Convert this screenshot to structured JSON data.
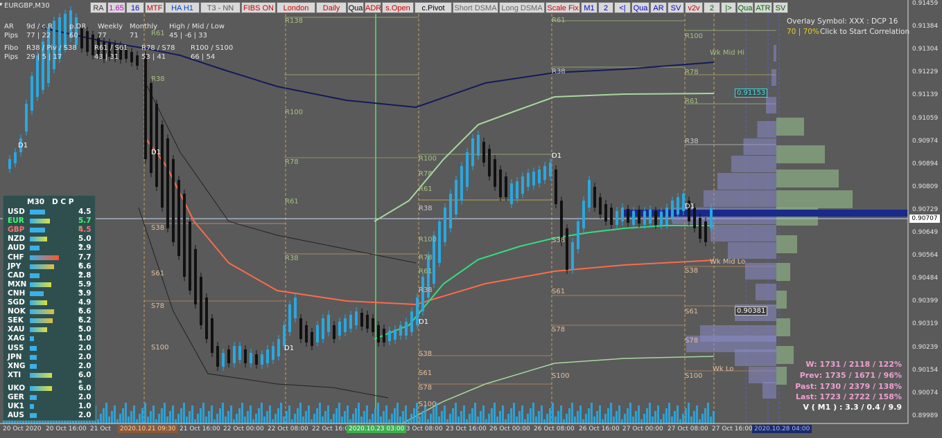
{
  "window": {
    "title": "EURGBP,M30"
  },
  "toolbar": [
    {
      "label": "RA",
      "color": "#333333"
    },
    {
      "label": "1.65",
      "color": "#cc00cc"
    },
    {
      "label": "16",
      "color": "#0000cc"
    },
    {
      "label": "MTF",
      "color": "#cc0000"
    },
    {
      "label": "HA H1",
      "color": "#0044cc"
    },
    {
      "label": "T3 - NN",
      "color": "#555555"
    },
    {
      "label": "FIBS ON",
      "color": "#cc0000"
    },
    {
      "label": "London",
      "color": "#cc0000"
    },
    {
      "label": "Daily",
      "color": "#cc0000"
    },
    {
      "label": "Qua",
      "color": "#000000"
    },
    {
      "label": "ADR",
      "color": "#cc0000"
    },
    {
      "label": "s.Open",
      "color": "#cc0000"
    },
    {
      "label": "c.Pivot",
      "color": "#000000"
    },
    {
      "label": "Short DSMA",
      "color": "#666666"
    },
    {
      "label": "Long DSMA",
      "color": "#666666"
    },
    {
      "label": "Scale Fix",
      "color": "#cc0000"
    },
    {
      "label": "M1",
      "color": "#0000cc"
    },
    {
      "label": "2",
      "color": "#0000cc"
    },
    {
      "label": "<|",
      "color": "#0000cc"
    },
    {
      "label": "Qua",
      "color": "#0000cc"
    },
    {
      "label": "AR",
      "color": "#0000cc"
    },
    {
      "label": "SV",
      "color": "#0000cc"
    },
    {
      "label": "v2v",
      "color": "#cc0000"
    },
    {
      "label": "2",
      "color": "#006600"
    },
    {
      "label": "|>",
      "color": "#006600"
    },
    {
      "label": "Qua",
      "color": "#006600"
    },
    {
      "label": "ATR",
      "color": "#006600"
    },
    {
      "label": "SV",
      "color": "#006600"
    }
  ],
  "price_axis": [
    "0.91459",
    "0.91384",
    "0.91304",
    "0.91229",
    "0.91139",
    "0.91059",
    "0.90974",
    "0.90894",
    "0.90809",
    "0.90729",
    "0.90649",
    "0.90564",
    "0.90484",
    "0.90399",
    "0.90319",
    "0.90239",
    "0.90154",
    "0.90074",
    "0.89989"
  ],
  "price_current": "0.90707",
  "price_markers": [
    {
      "label": "0.91153",
      "color": "#44dddd"
    },
    {
      "label": "0.90381",
      "color": "#ffffff"
    }
  ],
  "time_axis": [
    "20 Oct 2020",
    "20 Oct 16:00",
    "21 Oct",
    "21 Oct 16:00",
    "22 Oct 00:00",
    "22 Oct 08:00",
    "22 Oct 16:00",
    "23 Oct 08:00",
    "23 Oct 16:00",
    "26 Oct 00:00",
    "26 Oct 08:00",
    "26 Oct 16:00",
    "27 Oct 00:00",
    "27 Oct 08:00",
    "27 Oct 16:00"
  ],
  "time_highlights": [
    {
      "label": "2020.10.21 09:30",
      "bg": "#8a5a3a",
      "color": "#ffd0a0"
    },
    {
      "label": "2020.10.23 03:00",
      "bg": "#3ab04a",
      "color": "#ffffff"
    },
    {
      "label": "2020.10.28 04:00",
      "bg": "#1a2a6a",
      "color": "#aab4ff"
    }
  ],
  "top_left_info": {
    "row1": [
      "AR",
      "9d / c.R",
      "p.DR",
      "Weekly",
      "Monthly",
      "High / Mid / Low"
    ],
    "row2": [
      "Pips",
      "77 | 22",
      "60",
      "77",
      "71",
      "45 | -6 | 33"
    ],
    "row3": [
      "Fibo",
      "R38 / Piv / S38",
      "R61 / S61",
      "R78 / S78",
      "R100 / S100"
    ],
    "row4": [
      "Pips",
      "29 | 5 | 17",
      "43 | 31",
      "53 | 41",
      "66 | 54"
    ]
  },
  "overlay": {
    "line1": "Overlay Symbol: XXX : DCP 16",
    "line2_pct": "70 | 70%",
    "line2_text": "Click to Start Correlation"
  },
  "strength_panel": {
    "title": "M30   D C P",
    "rows": [
      {
        "name": "USD",
        "value": "4.5",
        "name_color": "#ffffff",
        "bar_color": "#3ab0e8",
        "bar_w": 0.32
      },
      {
        "name": "EUR",
        "value": "5.7 *",
        "name_color": "#40ff70",
        "bar_color": "#d8e040",
        "bar_w": 0.42
      },
      {
        "name": "GBP",
        "value": "4.5",
        "name_color": "#ff7070",
        "bar_color": "#3ab0e8",
        "bar_w": 0.32
      },
      {
        "name": "NZD",
        "value": "5.0 *",
        "name_color": "#ffffff",
        "bar_color": "#d8e040",
        "bar_w": 0.36
      },
      {
        "name": "AUD",
        "value": "2.9",
        "name_color": "#ffffff",
        "bar_color": "#3ab0e8",
        "bar_w": 0.2
      },
      {
        "name": "CHF",
        "value": "7.7 *",
        "name_color": "#ffffff",
        "bar_color": "#ff5530",
        "bar_w": 0.6
      },
      {
        "name": "JPY",
        "value": "6.6 *",
        "name_color": "#ffffff",
        "bar_color": "#e0c040",
        "bar_w": 0.5
      },
      {
        "name": "CAD",
        "value": "2.8",
        "name_color": "#ffffff",
        "bar_color": "#3ab0e8",
        "bar_w": 0.2
      },
      {
        "name": "MXN",
        "value": "5.9 *",
        "name_color": "#ffffff",
        "bar_color": "#d8e040",
        "bar_w": 0.44
      },
      {
        "name": "CNH",
        "value": "3.9",
        "name_color": "#ffffff",
        "bar_color": "#3ab0e8",
        "bar_w": 0.28
      },
      {
        "name": "SGD",
        "value": "4.9 *",
        "name_color": "#ffffff",
        "bar_color": "#d8e040",
        "bar_w": 0.36
      },
      {
        "name": "NOK",
        "value": "6.6 *",
        "name_color": "#ffffff",
        "bar_color": "#e0c040",
        "bar_w": 0.5
      },
      {
        "name": "SEK",
        "value": "6.2 *",
        "name_color": "#ffffff",
        "bar_color": "#e0c040",
        "bar_w": 0.47
      },
      {
        "name": "XAU",
        "value": "5.0 *",
        "name_color": "#ffffff",
        "bar_color": "#d8e040",
        "bar_w": 0.36
      },
      {
        "name": "XAG",
        "value": "1.0",
        "name_color": "#ffffff",
        "bar_color": "#3ab0e8",
        "bar_w": 0.08
      },
      {
        "name": "US5",
        "value": "2.0",
        "name_color": "#ffffff",
        "bar_color": "#3ab0e8",
        "bar_w": 0.14
      },
      {
        "name": "JPN",
        "value": "2.0",
        "name_color": "#ffffff",
        "bar_color": "#3ab0e8",
        "bar_w": 0.14
      },
      {
        "name": "XNG",
        "value": "2.0",
        "name_color": "#ffffff",
        "bar_color": "#3ab0e8",
        "bar_w": 0.14
      },
      {
        "name": "XTI",
        "value": "6.0 *",
        "name_color": "#ffffff",
        "bar_color": "#d8e040",
        "bar_w": 0.46
      },
      {
        "name": "UKO",
        "value": "6.0",
        "name_color": "#ffffff",
        "bar_color": "#d8e040",
        "bar_w": 0.46
      },
      {
        "name": "GER",
        "value": "2.0",
        "name_color": "#ffffff",
        "bar_color": "#3ab0e8",
        "bar_w": 0.14
      },
      {
        "name": "UK1",
        "value": "1.0",
        "name_color": "#ffffff",
        "bar_color": "#3ab0e8",
        "bar_w": 0.08
      },
      {
        "name": "AUS",
        "value": "2.0",
        "name_color": "#ffffff",
        "bar_color": "#3ab0e8",
        "bar_w": 0.14
      }
    ]
  },
  "stats": {
    "w": "W: 1731 / 2118 / 122%",
    "prev": "Prev: 1735 / 1671 / 96%",
    "past": "Past: 1730 / 2379 / 138%",
    "last": "Last: 1723 / 2722 / 158%",
    "vol": "V ( M1 ) : 3.3 / 0.4 / 9.9"
  },
  "chart_levels": [
    "R138",
    "R100",
    "R78",
    "R61",
    "R38",
    "R61",
    "R38",
    "R100",
    "R78",
    "R61",
    "R38",
    "S38",
    "S61",
    "S78",
    "S100",
    "R100",
    "R78",
    "R61",
    "R38",
    "S38",
    "S61",
    "S78",
    "S100",
    "R61",
    "R38",
    "R100",
    "R78",
    "R61",
    "R38",
    "S38",
    "S61",
    "S78",
    "S100",
    "S38",
    "S61",
    "S78",
    "S100",
    "D1",
    "D1",
    "D1",
    "D1",
    "D1",
    "D1",
    "Wk Mid Hi",
    "Wk Mid Lo",
    "Wk Lo"
  ],
  "colors": {
    "background": "#5a5a5a",
    "bull_candle": "#29a8e0",
    "bear_candle": "#111111",
    "ma_slow": "#141a5a",
    "ma_mid": "#ff6a4a",
    "ma_fast": "#30e080",
    "ma_green": "#a8d8a0",
    "volume": "#29a8e0",
    "accent": "#3ab04a"
  }
}
